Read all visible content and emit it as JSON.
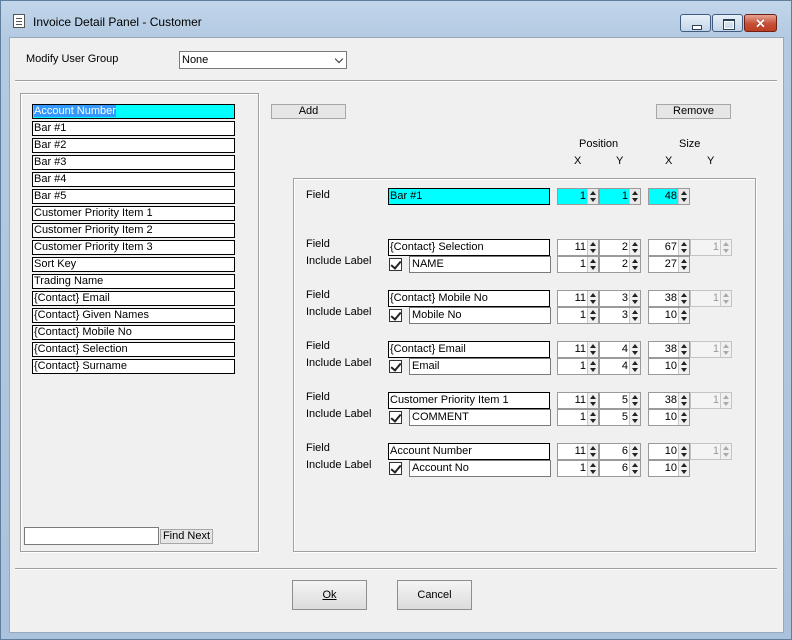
{
  "window": {
    "title": "Invoice Detail Panel - Customer",
    "close_glyph": "✕"
  },
  "user_group": {
    "label": "Modify User Group",
    "value": "None"
  },
  "field_list": [
    "Account Number",
    "Bar #1",
    "Bar #2",
    "Bar #3",
    "Bar #4",
    "Bar #5",
    "Customer Priority Item 1",
    "Customer Priority Item 2",
    "Customer Priority Item 3",
    "Sort Key",
    "Trading Name",
    "{Contact} Email",
    "{Contact} Given Names",
    "{Contact} Mobile No",
    "{Contact} Selection",
    "{Contact} Surname"
  ],
  "selected_index": 0,
  "find": {
    "value": "",
    "button": "Find Next"
  },
  "buttons": {
    "add": "Add",
    "remove": "Remove",
    "ok": "Ok",
    "cancel": "Cancel"
  },
  "headers": {
    "position": "Position",
    "size": "Size",
    "x": "X",
    "y": "Y"
  },
  "labels": {
    "field": "Field",
    "include_label": "Include Label"
  },
  "current": {
    "field": "Bar #1",
    "pos_x": "1",
    "pos_y": "1",
    "size_x": "48"
  },
  "rows": [
    {
      "field": "{Contact} Selection",
      "label_text": "NAME",
      "pos_x": "11",
      "pos_y": "2",
      "size_x": "67",
      "size_y": "1",
      "label_x": "1",
      "label_y": "2",
      "label_size": "27",
      "include": true
    },
    {
      "field": "{Contact} Mobile No",
      "label_text": "Mobile No",
      "pos_x": "11",
      "pos_y": "3",
      "size_x": "38",
      "size_y": "1",
      "label_x": "1",
      "label_y": "3",
      "label_size": "10",
      "include": true
    },
    {
      "field": "{Contact} Email",
      "label_text": "Email",
      "pos_x": "11",
      "pos_y": "4",
      "size_x": "38",
      "size_y": "1",
      "label_x": "1",
      "label_y": "4",
      "label_size": "10",
      "include": true
    },
    {
      "field": "Customer Priority Item 1",
      "label_text": "COMMENT",
      "pos_x": "11",
      "pos_y": "5",
      "size_x": "38",
      "size_y": "1",
      "label_x": "1",
      "label_y": "5",
      "label_size": "10",
      "include": true
    },
    {
      "field": "Account Number",
      "label_text": "Account No",
      "pos_x": "11",
      "pos_y": "6",
      "size_x": "10",
      "size_y": "1",
      "label_x": "1",
      "label_y": "6",
      "label_size": "10",
      "include": true
    }
  ]
}
